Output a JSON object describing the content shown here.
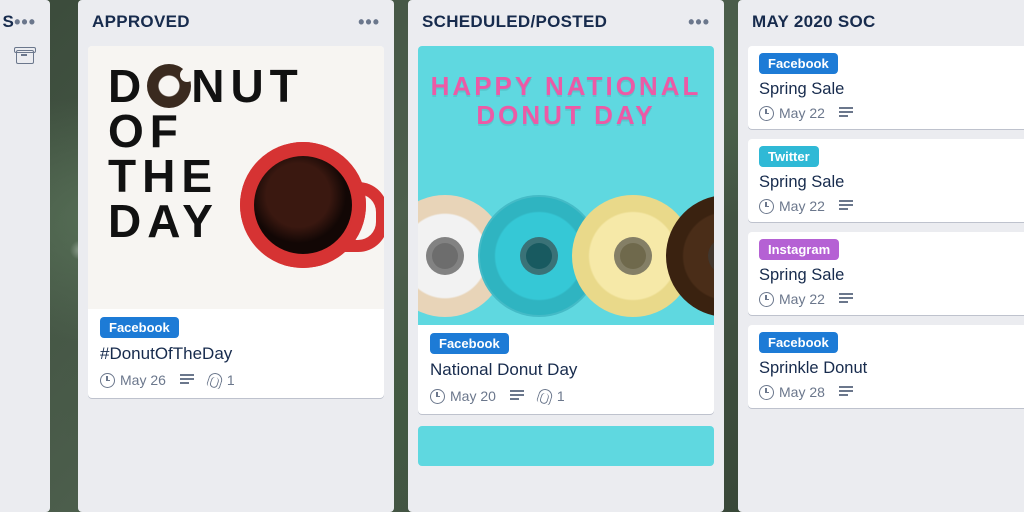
{
  "columns": {
    "partial_left": {
      "title_fragment": "S"
    },
    "approved": {
      "title": "APPROVED",
      "card": {
        "tag": {
          "label": "Facebook",
          "kind": "facebook"
        },
        "title": "#DonutOfTheDay",
        "date": "May 26",
        "attachments": "1",
        "cover_text": {
          "l1_a": "D",
          "l1_b": "NUT",
          "l2": "OF",
          "l3": "THE",
          "l4": "DAY"
        }
      }
    },
    "scheduled": {
      "title": "SCHEDULED/POSTED",
      "card": {
        "tag": {
          "label": "Facebook",
          "kind": "facebook"
        },
        "title": "National Donut Day",
        "date": "May 20",
        "attachments": "1",
        "cover_text": {
          "l1": "HAPPY NATIONAL",
          "l2": "DONUT DAY"
        }
      }
    },
    "may2020": {
      "title": "MAY 2020 SOC",
      "cards": [
        {
          "tag": {
            "label": "Facebook",
            "kind": "facebook"
          },
          "title": "Spring Sale",
          "date": "May 22"
        },
        {
          "tag": {
            "label": "Twitter",
            "kind": "twitter"
          },
          "title": "Spring Sale",
          "date": "May 22"
        },
        {
          "tag": {
            "label": "Instagram",
            "kind": "instagram"
          },
          "title": "Spring Sale",
          "date": "May 22"
        },
        {
          "tag": {
            "label": "Facebook",
            "kind": "facebook"
          },
          "title": "Sprinkle Donut",
          "date": "May 28"
        }
      ]
    }
  }
}
